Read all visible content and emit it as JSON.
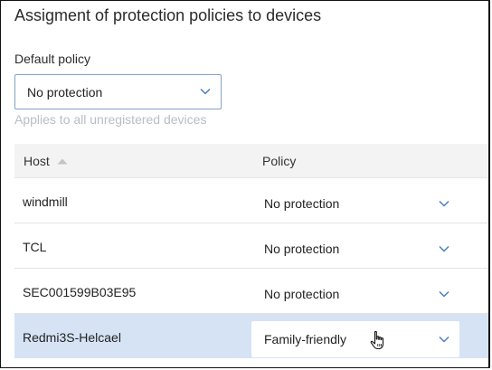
{
  "page": {
    "title": "Assigment of protection policies to devices"
  },
  "default_policy": {
    "label": "Default policy",
    "value": "No protection",
    "helper": "Applies to all unregistered devices"
  },
  "table": {
    "columns": {
      "host": "Host",
      "policy": "Policy"
    },
    "sort": {
      "column": "host",
      "direction": "ascending"
    },
    "rows": [
      {
        "host": "windmill",
        "policy": "No protection",
        "selected": false
      },
      {
        "host": "TCL",
        "policy": "No protection",
        "selected": false
      },
      {
        "host": "SEC001599B03E95",
        "policy": "No protection",
        "selected": false
      },
      {
        "host": "Redmi3S-Helcael",
        "policy": "Family-friendly",
        "selected": true
      }
    ]
  },
  "colors": {
    "accent": "#4a7fc1",
    "selected_row": "#d5e3f5",
    "header_bg": "#f3f3f3",
    "helper_text": "#b8bec4"
  },
  "icons": {
    "dropdown": "chevron-down-icon",
    "sort": "sort-ascending-icon",
    "cursor": "hand-pointer-icon"
  }
}
